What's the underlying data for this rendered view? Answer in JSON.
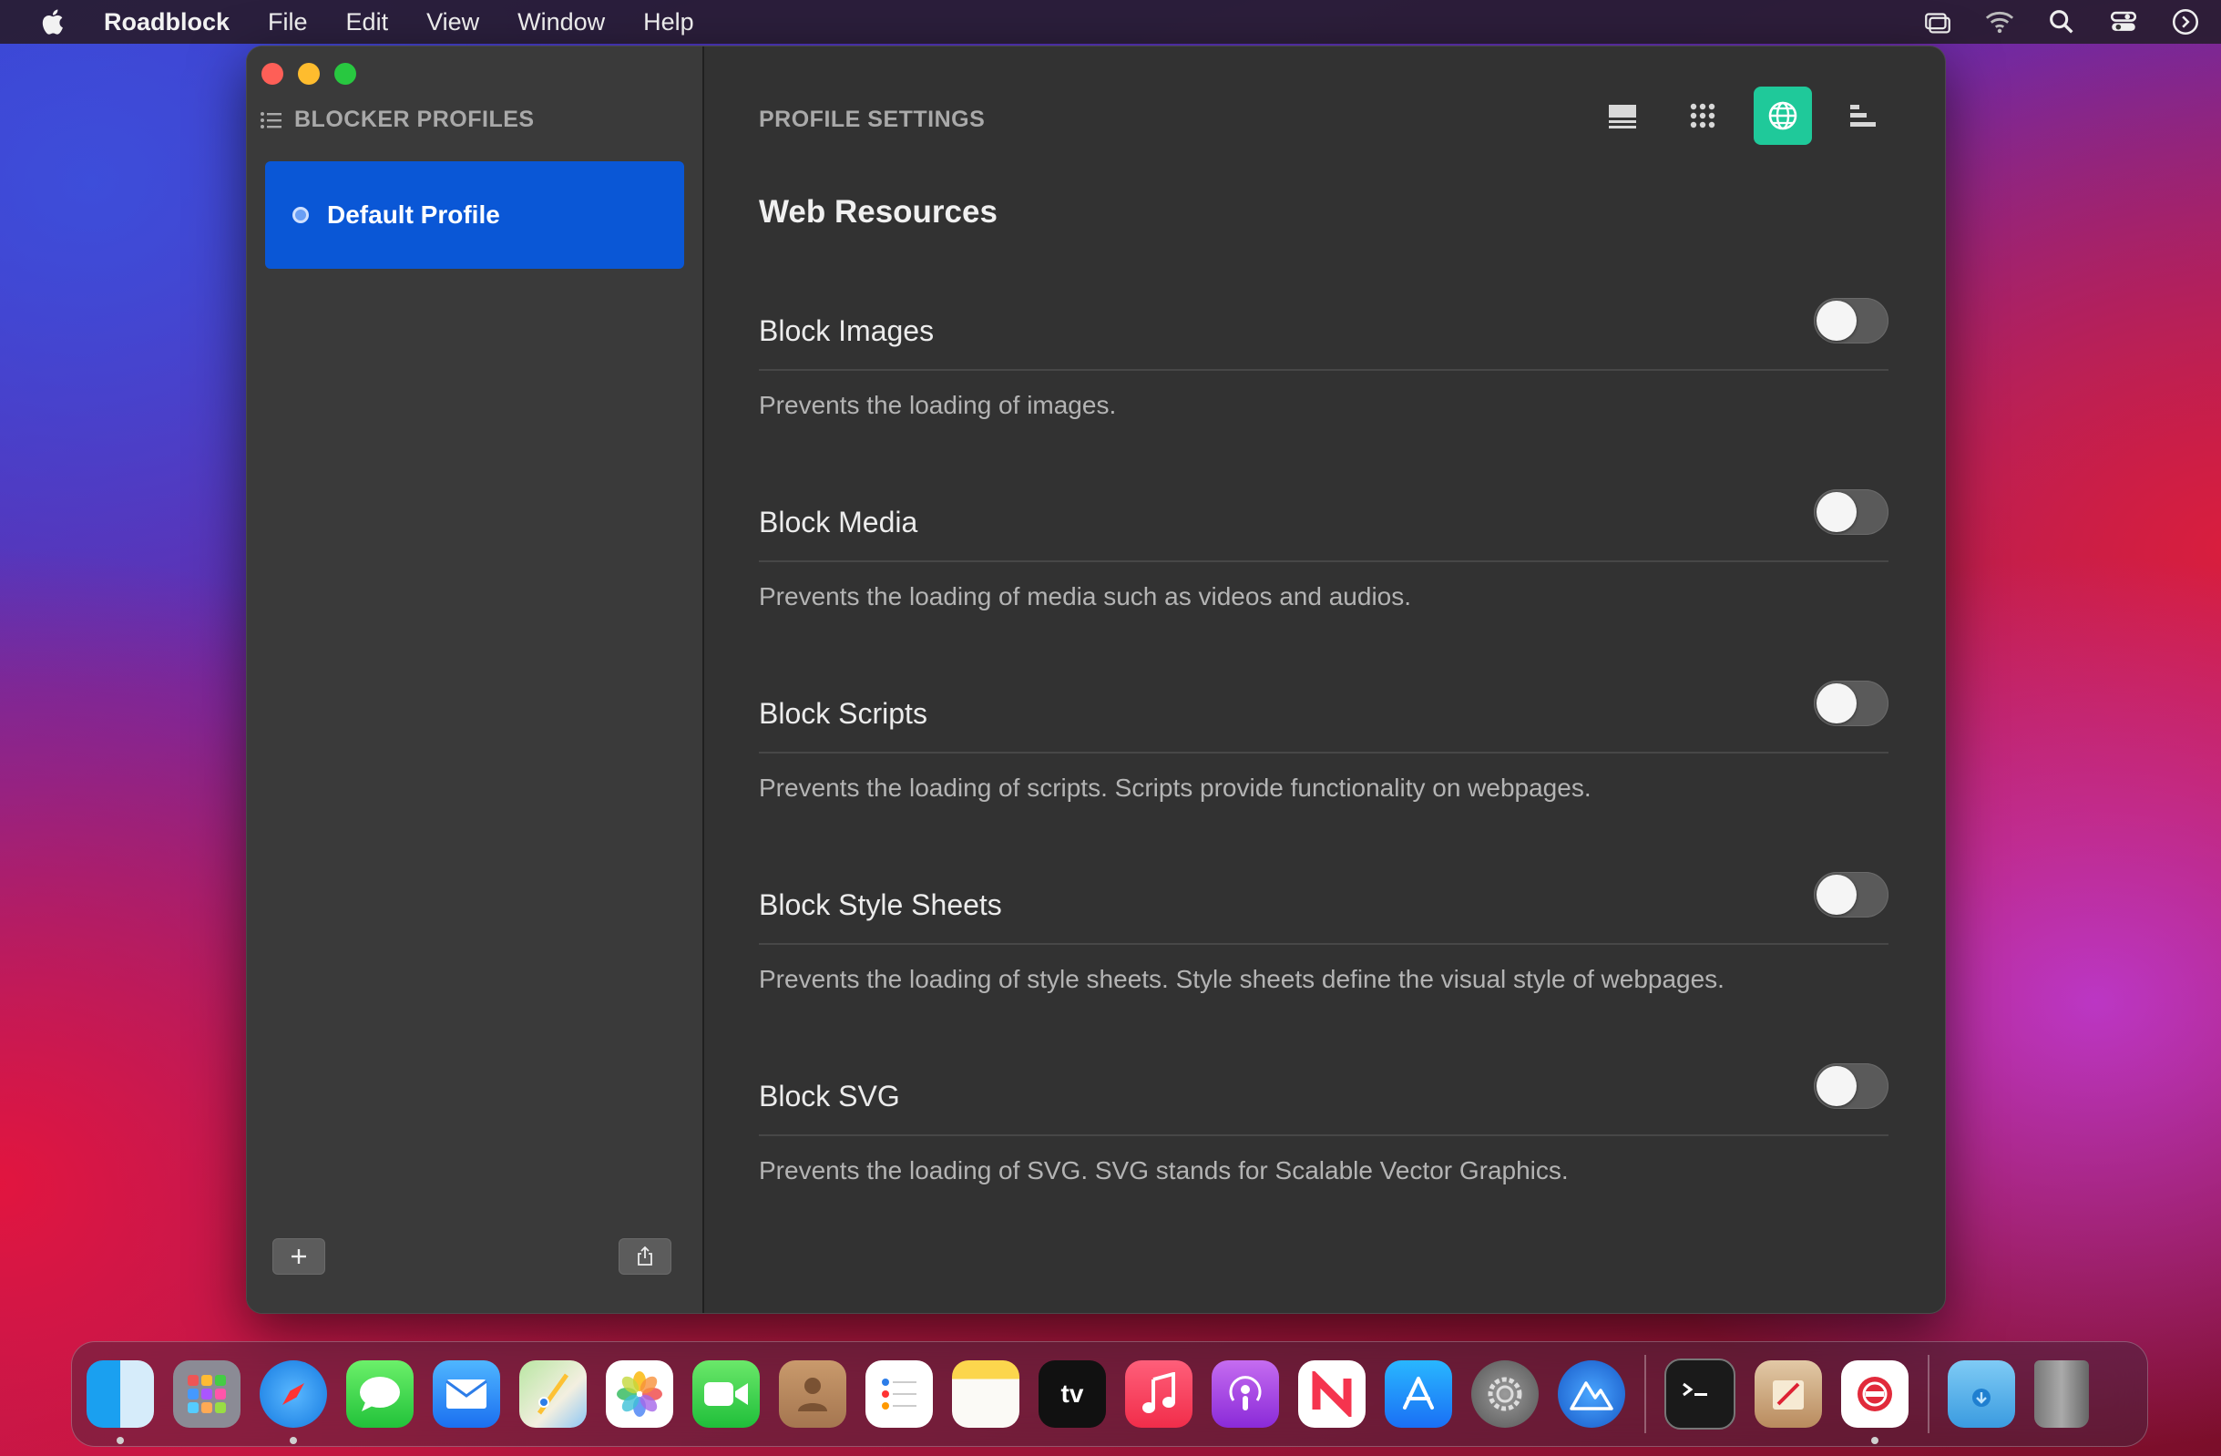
{
  "menubar": {
    "app_name": "Roadblock",
    "items": [
      "File",
      "Edit",
      "View",
      "Window",
      "Help"
    ]
  },
  "sidebar": {
    "header": "BLOCKER PROFILES",
    "profiles": [
      {
        "label": "Default Profile",
        "selected": true
      }
    ]
  },
  "main": {
    "header": "PROFILE SETTINGS",
    "toolbar": [
      {
        "icon": "content-list-icon",
        "active": false
      },
      {
        "icon": "grid-icon",
        "active": false
      },
      {
        "icon": "globe-icon",
        "active": true
      },
      {
        "icon": "bars-icon",
        "active": false
      }
    ],
    "section_title": "Web Resources",
    "settings": [
      {
        "label": "Block Images",
        "description": "Prevents the loading of images.",
        "enabled": false
      },
      {
        "label": "Block Media",
        "description": "Prevents the loading of media such as videos and audios.",
        "enabled": false
      },
      {
        "label": "Block Scripts",
        "description": "Prevents the loading of scripts. Scripts provide functionality on webpages.",
        "enabled": false
      },
      {
        "label": "Block Style Sheets",
        "description": "Prevents the loading of style sheets. Style sheets define the visual style of webpages.",
        "enabled": false
      },
      {
        "label": "Block SVG",
        "description": "Prevents the loading of SVG. SVG stands for Scalable Vector Graphics.",
        "enabled": false
      }
    ]
  },
  "dock": {
    "apps": [
      "Finder",
      "Launchpad",
      "Safari",
      "Messages",
      "Mail",
      "Maps",
      "Photos",
      "FaceTime",
      "Contacts",
      "Reminders",
      "Notes",
      "TV",
      "Music",
      "Podcasts",
      "News",
      "App Store",
      "System Preferences",
      "Altimeter",
      "Terminal",
      "Script Editor",
      "Roadblock",
      "Downloads",
      "Trash"
    ],
    "tv_label": "tv"
  },
  "colors": {
    "accent_blue": "#0a57d6",
    "active_tool": "#1fc99a"
  }
}
